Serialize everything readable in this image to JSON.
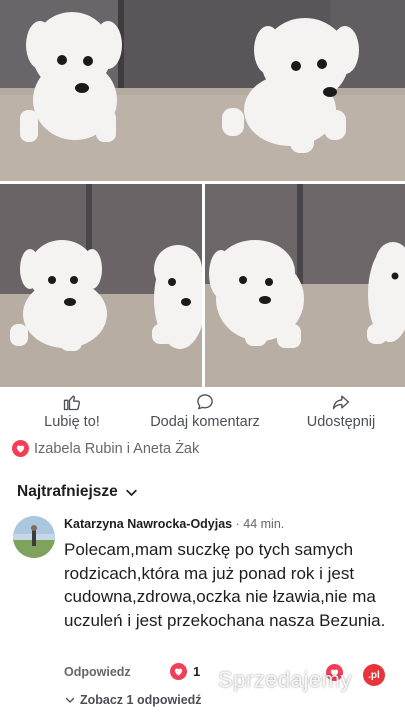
{
  "post": {
    "actions": {
      "like_label": "Lubię to!",
      "comment_label": "Dodaj komentarz",
      "share_label": "Udostępnij"
    },
    "reactions": {
      "names": "Izabela Rubin i Aneta Żak",
      "icon": "heart-icon"
    }
  },
  "comments": {
    "sort_label": "Najtrafniejsze",
    "items": [
      {
        "author": "Katarzyna Nawrocka-Odyjas",
        "time": "· 44 min.",
        "text": "Polecam,mam suczkę po tych samych rodzicach,która ma już ponad rok i jest cudowna,zdrowa,oczka nie łzawia,nie ma uczuleń i jest przekochana nasza Bezunia.",
        "reply_label": "Odpowiedz",
        "like_count": "1",
        "see_replies_label": "Zobacz 1 odpowiedź"
      }
    ]
  },
  "watermark": {
    "text": "Sprzedajemy",
    "badge": ".pl"
  },
  "colors": {
    "heart": "#f33e58",
    "text_primary": "#1c1e21",
    "text_secondary": "#65676b",
    "watermark_badge": "#e8343b"
  }
}
